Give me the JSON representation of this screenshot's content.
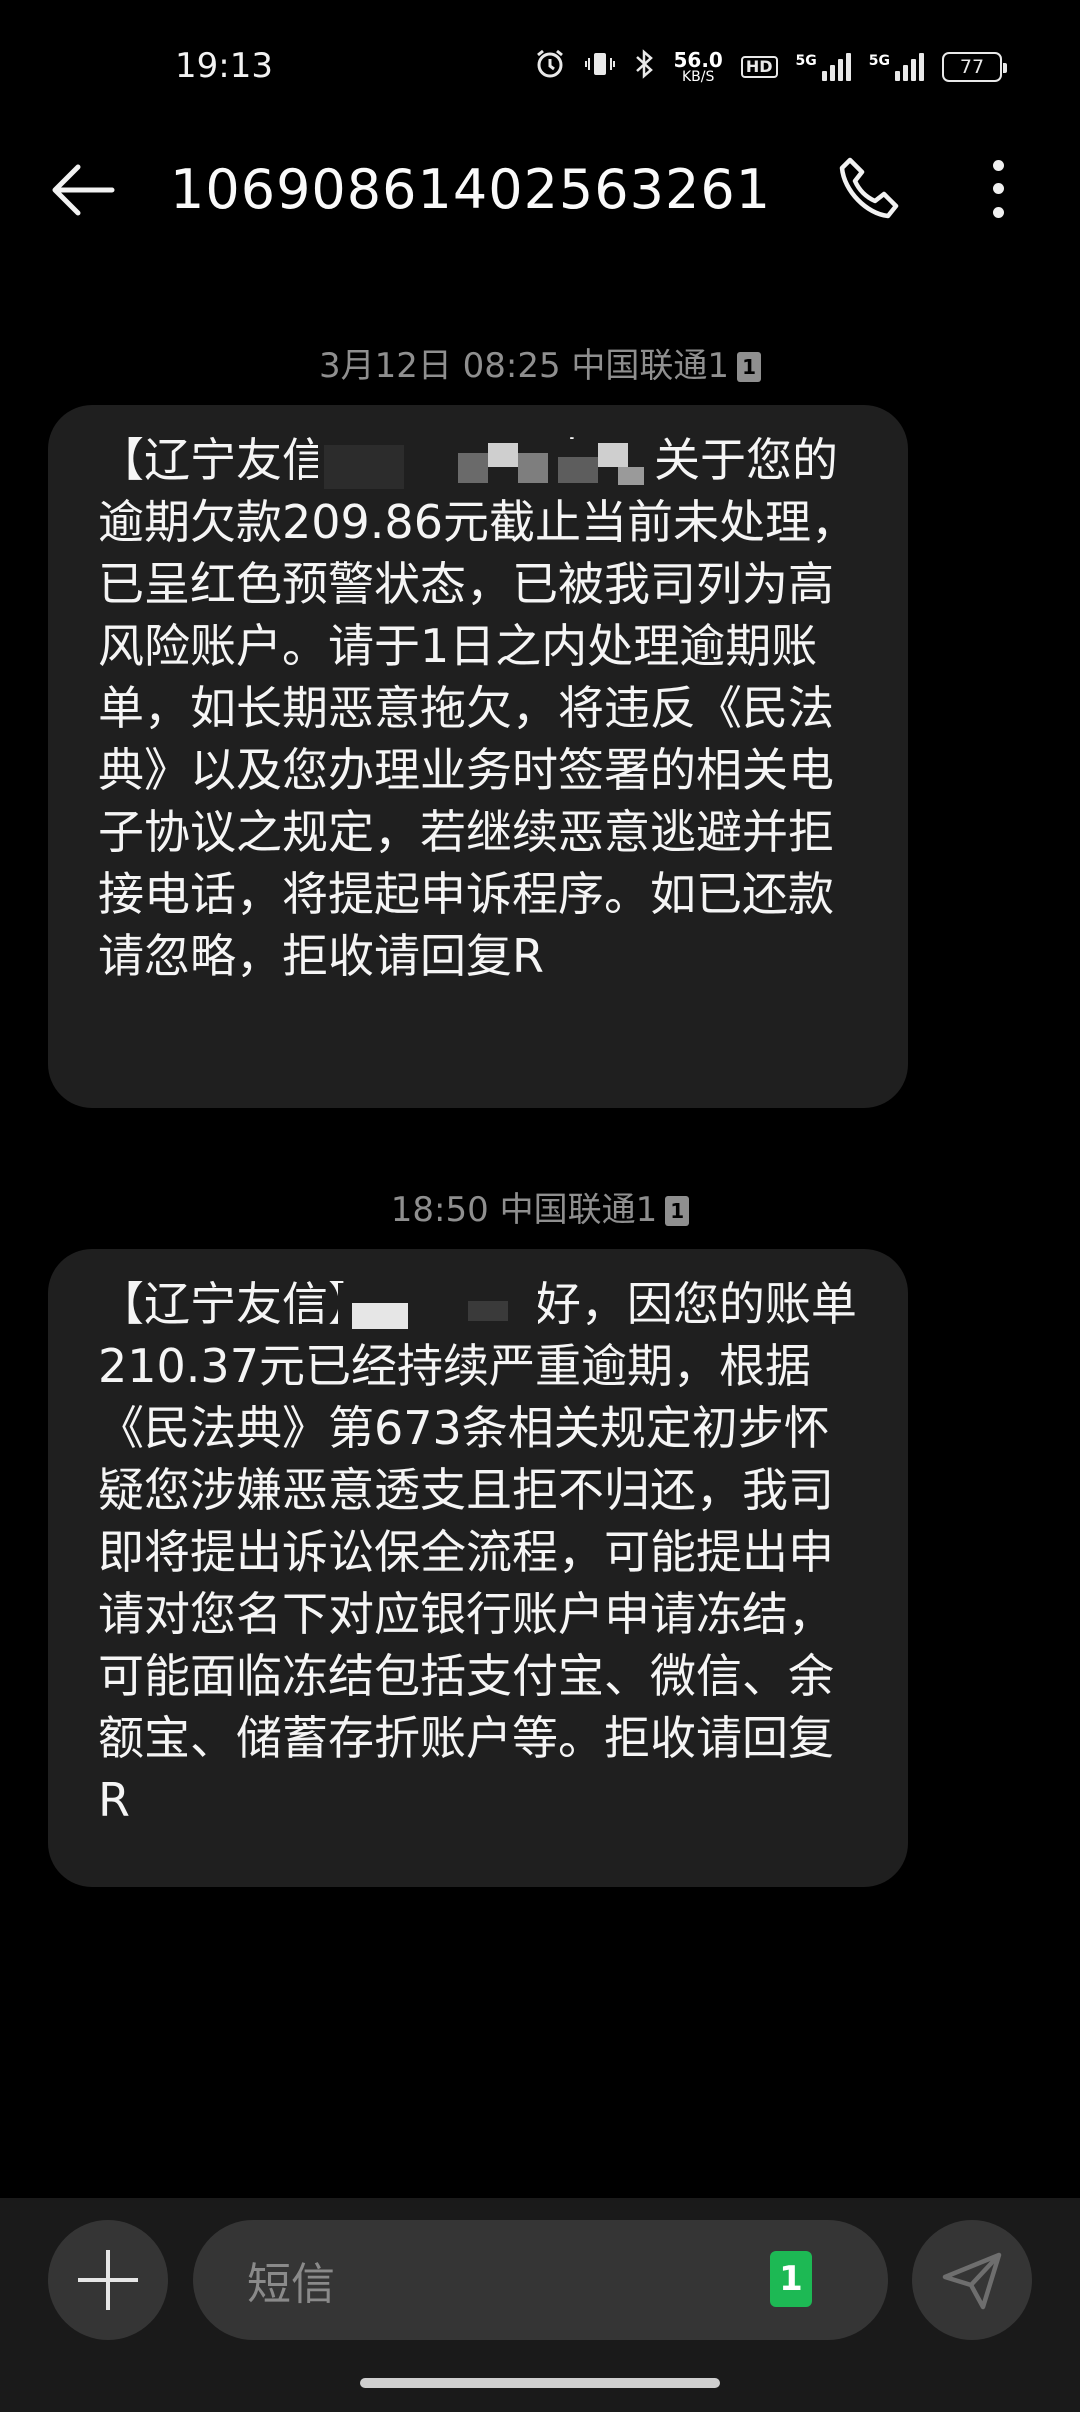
{
  "status_bar": {
    "time": "19:13",
    "speed_value": "56.0",
    "speed_unit": "KB/S",
    "hd": "HD",
    "sim1_label": "5G",
    "sim2_label": "5G",
    "battery": "77"
  },
  "header": {
    "title": "10690861402563261"
  },
  "messages": [
    {
      "timestamp": "3月12日 08:25 中国联通1",
      "sim": "1",
      "text": "【辽宁友信                好，关于您的逾期欠款209.86元截止当前未处理，已呈红色预警状态，已被我司列为高风险账户。请于1日之内处理逾期账单，如长期恶意拖欠，将违反《民法典》以及您办理业务时签署的相关电子协议之规定，若继续恶意逃避并拒接电话，将提起申诉程序。如已还款请忽略，拒收请回复R"
    },
    {
      "timestamp": "18:50 中国联通1",
      "sim": "1",
      "text": "【辽宁友信】           好，因您的账单210.37元已经持续严重逾期，根据《民法典》第673条相关规定初步怀疑您涉嫌恶意透支且拒不归还，我司即将提出诉讼保全流程，可能提出申请对您名下对应银行账户申请冻结，可能面临冻结包括支付宝、微信、余额宝、储蓄存折账户等。拒收请回复R"
    }
  ],
  "composer": {
    "placeholder": "短信",
    "sim_badge": "1"
  },
  "colors": {
    "background": "#000000",
    "bubble": "#1f1f1f",
    "bar": "#1a1a1a",
    "control": "#353535",
    "sim_green": "#1db954"
  }
}
